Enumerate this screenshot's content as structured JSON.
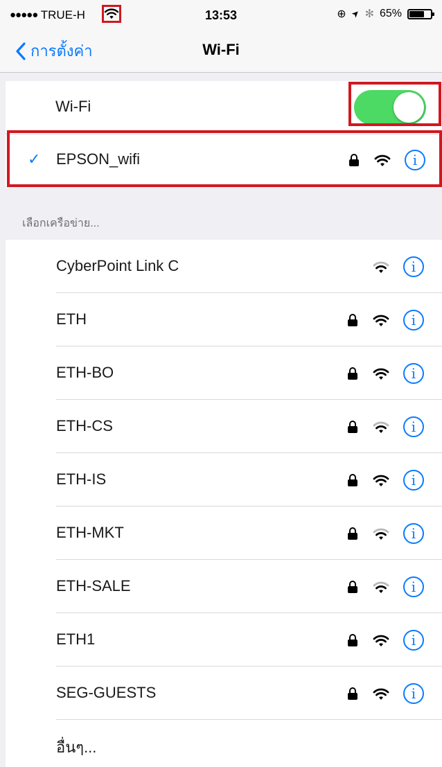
{
  "status_bar": {
    "signal_dots": "●●●●●",
    "carrier": "TRUE-H",
    "time": "13:53",
    "lock_rotation": "⊕",
    "location_arrow": "➤",
    "bluetooth": "✻",
    "battery_percent": "65%"
  },
  "nav": {
    "back_label": "การตั้งค่า",
    "title": "Wi-Fi"
  },
  "wifi_toggle": {
    "label": "Wi-Fi",
    "on": true
  },
  "connected": {
    "name": "EPSON_wifi",
    "checkmark": "✓",
    "locked": true,
    "signal": "full"
  },
  "networks_header": "เลือกเครือข่าย...",
  "networks": [
    {
      "name": "CyberPoint Link C",
      "locked": false,
      "signal": "weak"
    },
    {
      "name": "ETH",
      "locked": true,
      "signal": "full"
    },
    {
      "name": "ETH-BO",
      "locked": true,
      "signal": "full"
    },
    {
      "name": "ETH-CS",
      "locked": true,
      "signal": "weak"
    },
    {
      "name": "ETH-IS",
      "locked": true,
      "signal": "full"
    },
    {
      "name": "ETH-MKT",
      "locked": true,
      "signal": "weak"
    },
    {
      "name": "ETH-SALE",
      "locked": true,
      "signal": "weak"
    },
    {
      "name": "ETH1",
      "locked": true,
      "signal": "full"
    },
    {
      "name": "SEG-GUESTS",
      "locked": true,
      "signal": "full"
    }
  ],
  "other": "อื่นๆ...",
  "info_glyph": "i",
  "colors": {
    "accent": "#0a7aff",
    "toggle_on": "#4cd964",
    "highlight": "#d01820"
  }
}
